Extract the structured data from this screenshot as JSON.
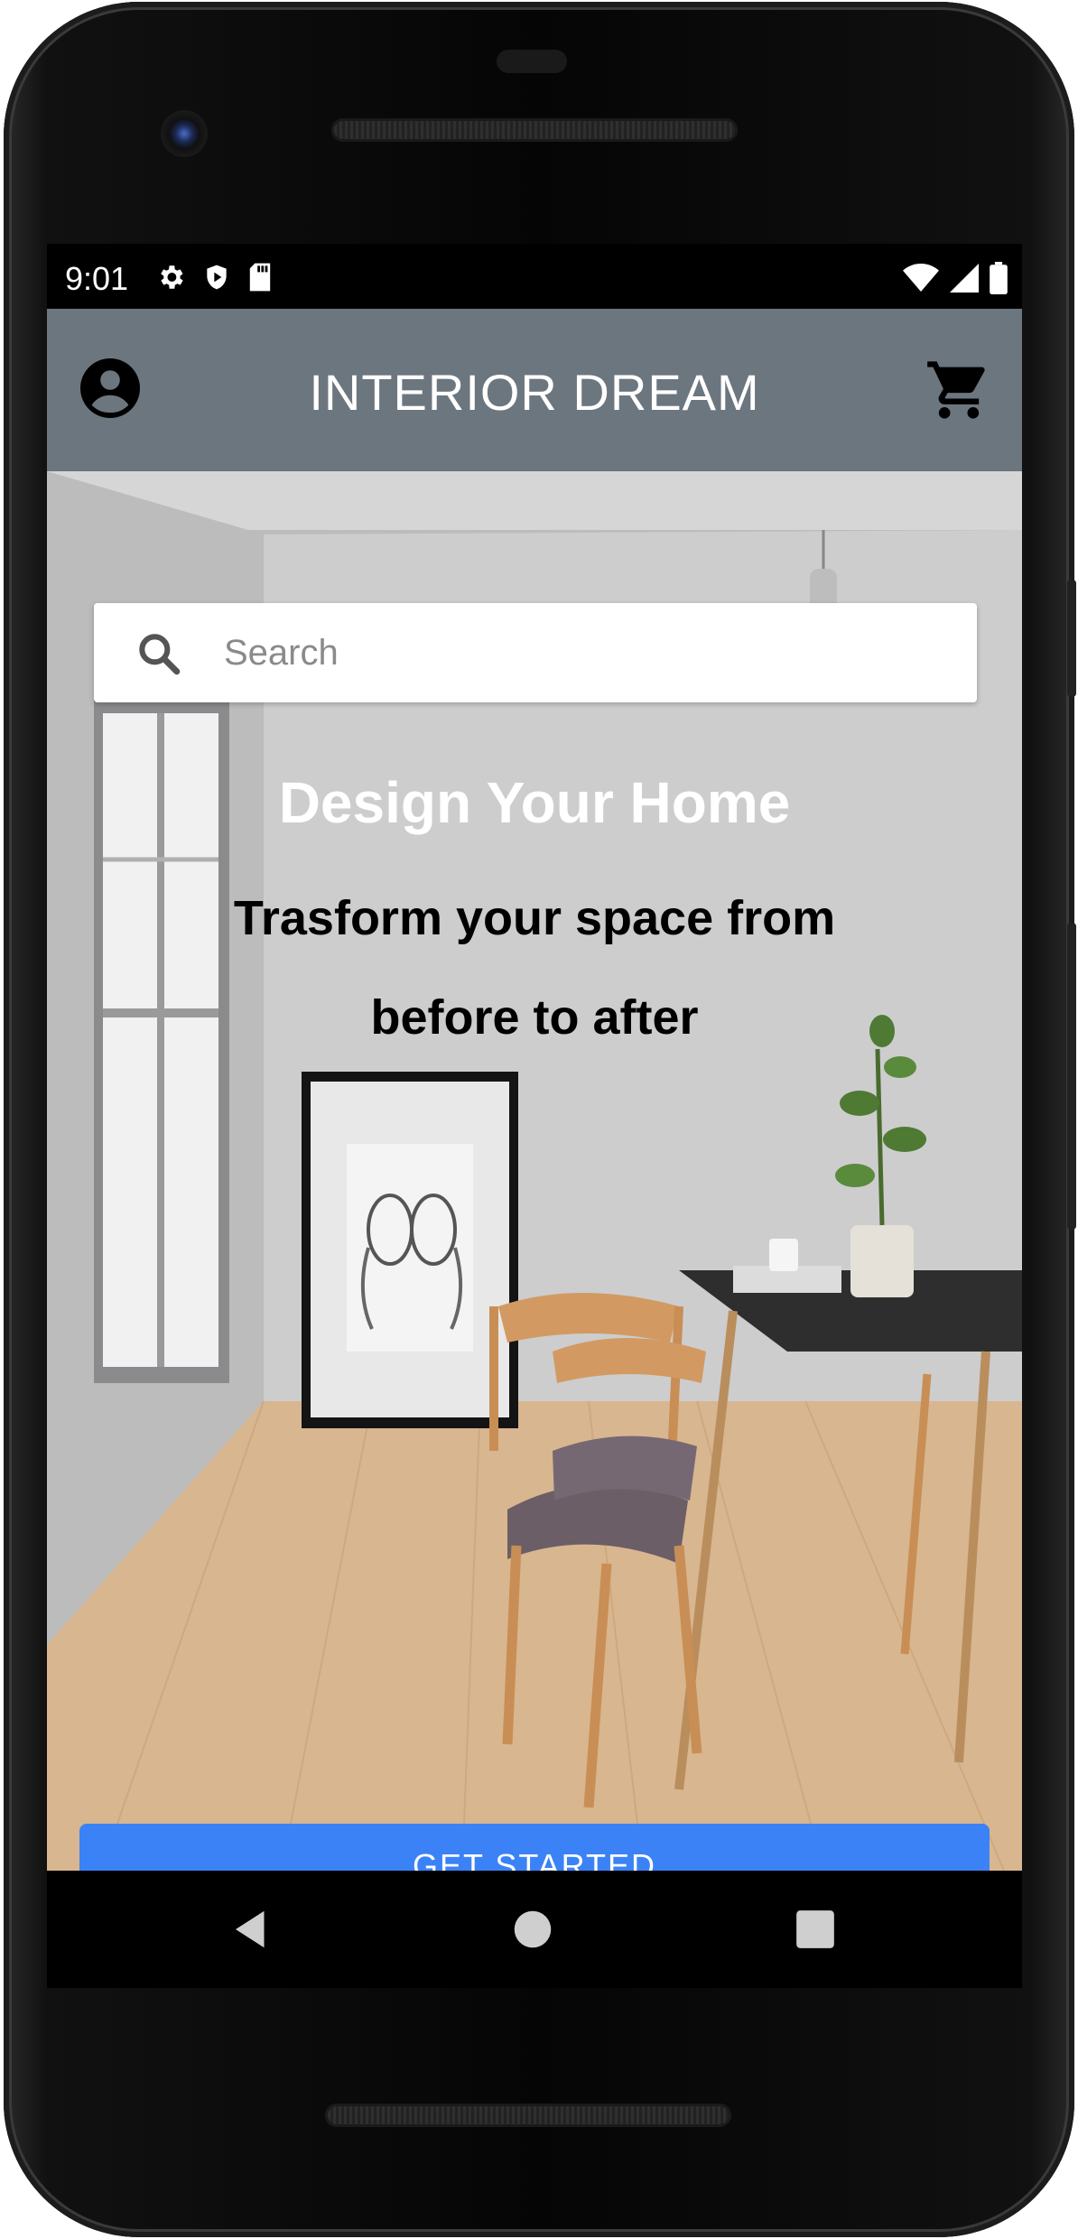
{
  "status_bar": {
    "time": "9:01",
    "left_icons": [
      "gear-icon",
      "shield-icon",
      "sd-card-icon"
    ],
    "right_icons": [
      "wifi-icon",
      "cell-signal-icon",
      "battery-icon"
    ]
  },
  "app_bar": {
    "title": "INTERIOR DREAM",
    "background": "#6c767f",
    "left_icon": "account-circle-icon",
    "right_icon": "shopping-cart-icon"
  },
  "search": {
    "placeholder": "Search",
    "value": ""
  },
  "hero": {
    "title": "Design Your Home",
    "subtitle": "Trasform your space from before to after"
  },
  "cta": {
    "label": "GET STARTED",
    "color": "#3b82f6"
  },
  "nav_bar": {
    "buttons": [
      "back-icon",
      "home-icon",
      "recents-icon"
    ]
  }
}
